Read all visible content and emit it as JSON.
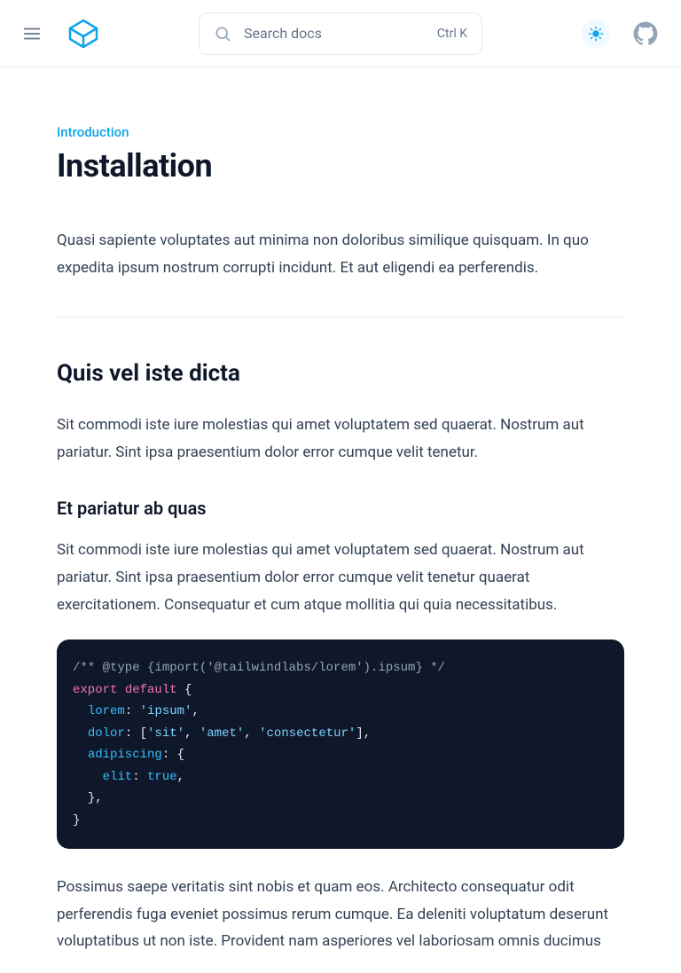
{
  "header": {
    "search_placeholder": "Search docs",
    "search_kbd": "Ctrl K"
  },
  "page": {
    "eyebrow": "Introduction",
    "title": "Installation",
    "lead": "Quasi sapiente voluptates aut minima non doloribus similique quisquam. In quo expedita ipsum nostrum corrupti incidunt. Et aut eligendi ea perferendis.",
    "section1_heading": "Quis vel iste dicta",
    "section1_para": "Sit commodi iste iure molestias qui amet voluptatem sed quaerat. Nostrum aut pariatur. Sint ipsa praesentium dolor error cumque velit tenetur.",
    "subsection1_heading": "Et pariatur ab quas",
    "subsection1_para": "Sit commodi iste iure molestias qui amet voluptatem sed quaerat. Nostrum aut pariatur. Sint ipsa praesentium dolor error cumque velit tenetur quaerat exercitationem. Consequatur et cum atque mollitia qui quia necessitatibus.",
    "para_after_code": "Possimus saepe veritatis sint nobis et quam eos. Architecto consequatur odit perferendis fuga eveniet possimus rerum cumque. Ea deleniti voluptatum deserunt voluptatibus ut non iste. Provident nam asperiores vel laboriosam omnis ducimus",
    "code": {
      "comment": "/** @type {import('@tailwindlabs/lorem').ipsum} */",
      "export_kw": "export",
      "default_kw": "default",
      "lorem_key": "lorem",
      "lorem_val": "'ipsum'",
      "dolor_key": "dolor",
      "dolor_vals": [
        "'sit'",
        "'amet'",
        "'consectetur'"
      ],
      "adipiscing_key": "adipiscing",
      "elit_key": "elit",
      "elit_val": "true"
    }
  }
}
